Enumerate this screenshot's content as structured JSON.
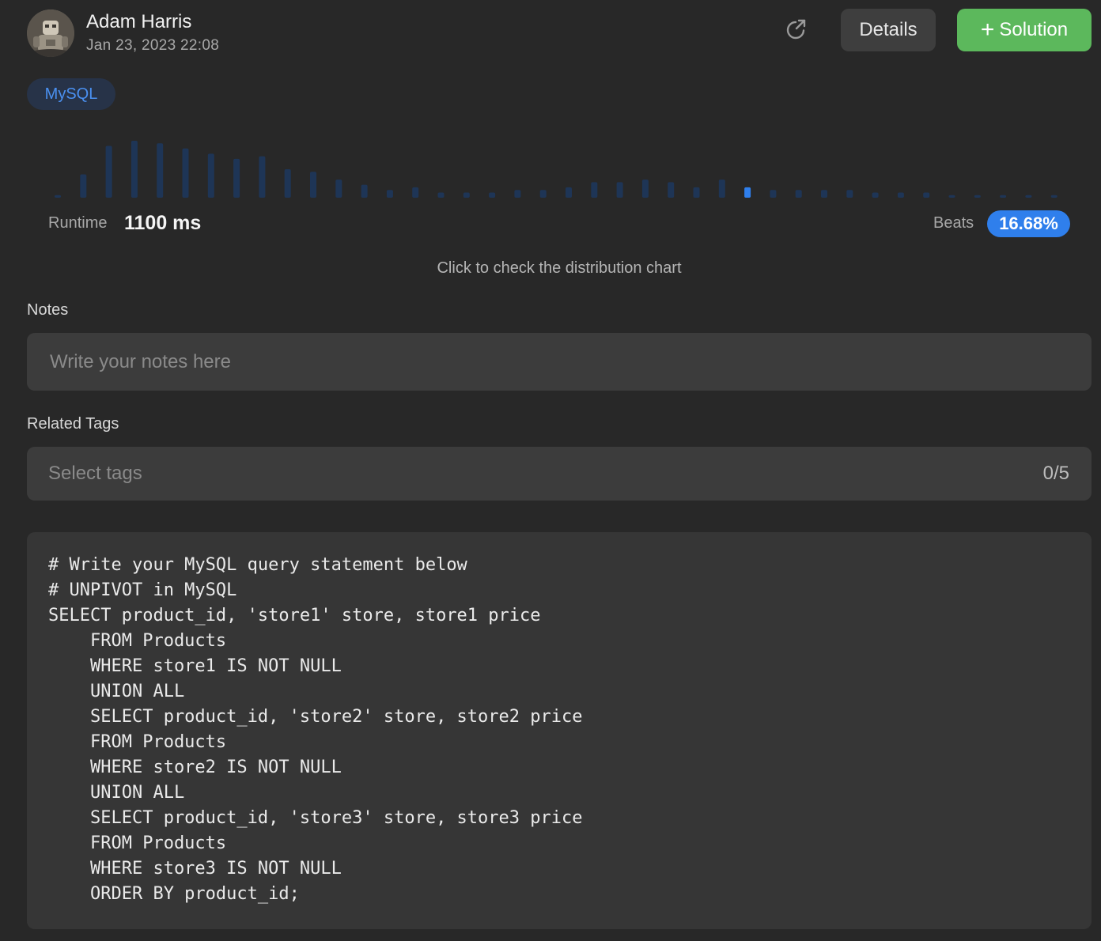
{
  "header": {
    "user_name": "Adam Harris",
    "date": "Jan 23, 2023 22:08",
    "details_label": "Details",
    "solution_label": "Solution",
    "solution_icon": "plus-icon",
    "share_icon": "share-icon"
  },
  "language_badge": "MySQL",
  "stats": {
    "runtime_label": "Runtime",
    "runtime_value": "1100 ms",
    "beats_label": "Beats",
    "beats_value": "16.68%"
  },
  "distribution_hint": "Click to check the distribution chart",
  "chart_data": {
    "type": "bar",
    "highlighted_index": 27,
    "values": [
      1,
      9,
      20,
      22,
      21,
      19,
      17,
      15,
      16,
      11,
      10,
      7,
      5,
      3,
      4,
      2,
      2,
      2,
      3,
      3,
      4,
      6,
      6,
      7,
      6,
      4,
      7,
      4,
      3,
      3,
      3,
      3,
      2,
      2,
      2,
      1,
      1,
      1,
      1,
      1
    ],
    "colors": {
      "bar": "#1e3556",
      "highlight": "#2f7fec"
    }
  },
  "notes": {
    "label": "Notes",
    "placeholder": "Write your notes here",
    "value": ""
  },
  "related_tags": {
    "label": "Related Tags",
    "placeholder": "Select tags",
    "count": "0/5"
  },
  "code": {
    "language": "MySQL",
    "lines": [
      "# Write your MySQL query statement below",
      "# UNPIVOT in MySQL",
      "SELECT product_id, 'store1' store, store1 price",
      "    FROM Products",
      "    WHERE store1 IS NOT NULL",
      "    UNION ALL",
      "    SELECT product_id, 'store2' store, store2 price",
      "    FROM Products",
      "    WHERE store2 IS NOT NULL",
      "    UNION ALL",
      "    SELECT product_id, 'store3' store, store3 price",
      "    FROM Products",
      "    WHERE store3 IS NOT NULL",
      "    ORDER BY product_id;"
    ]
  },
  "colors": {
    "background": "#282828",
    "accent_green": "#5cb85c",
    "accent_blue": "#2f7fec",
    "badge_text": "#4a90f0"
  }
}
